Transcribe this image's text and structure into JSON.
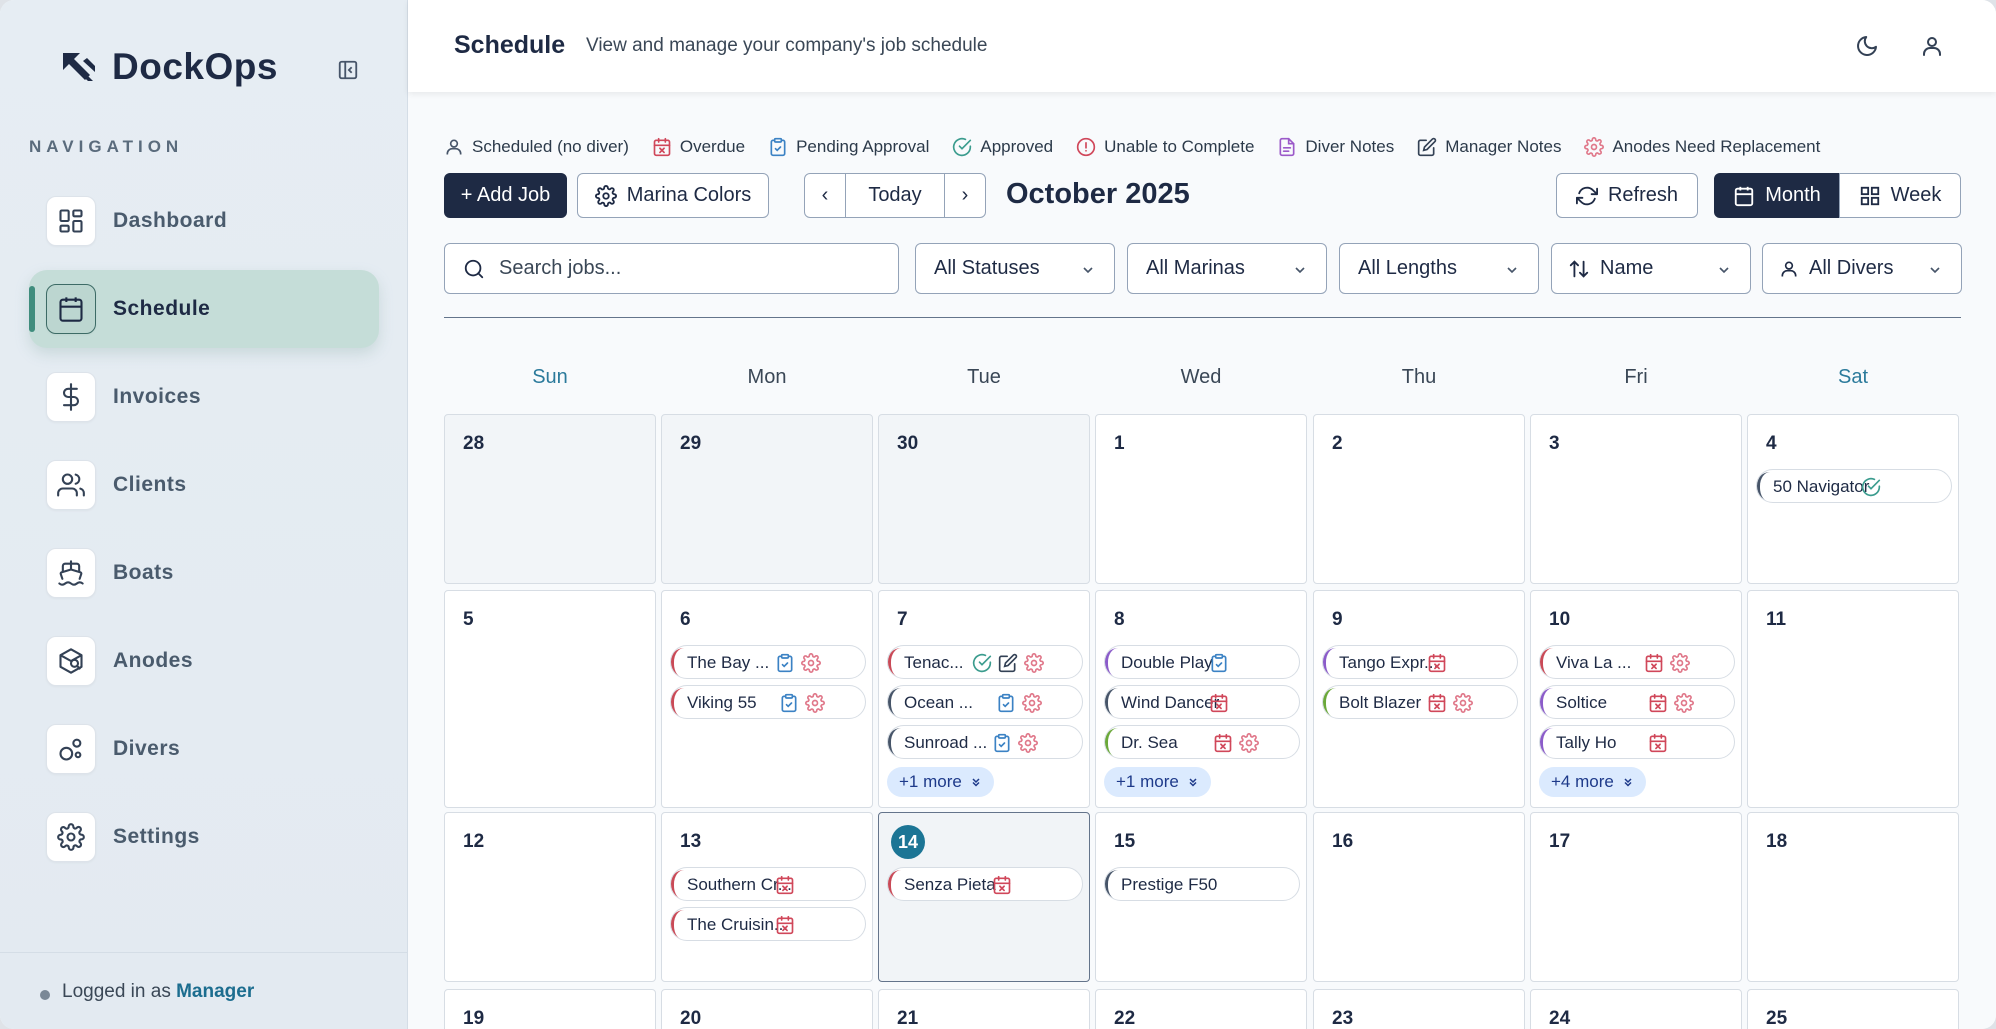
{
  "brand": {
    "name": "DockOps"
  },
  "sidebar": {
    "heading": "NAVIGATION",
    "items": [
      {
        "label": "Dashboard",
        "icon": "dashboard-icon"
      },
      {
        "label": "Schedule",
        "icon": "calendar-icon",
        "active": true
      },
      {
        "label": "Invoices",
        "icon": "dollar-icon"
      },
      {
        "label": "Clients",
        "icon": "users-icon"
      },
      {
        "label": "Boats",
        "icon": "boat-icon"
      },
      {
        "label": "Anodes",
        "icon": "anode-icon"
      },
      {
        "label": "Divers",
        "icon": "diver-icon"
      },
      {
        "label": "Settings",
        "icon": "gear-icon"
      }
    ],
    "footer": {
      "prefix": "Logged in as",
      "role": "Manager"
    }
  },
  "header": {
    "title": "Schedule",
    "subtitle": "View and manage your company's job schedule"
  },
  "legend": [
    {
      "label": "Scheduled (no diver)",
      "icon": "user-icon",
      "color": "#475569"
    },
    {
      "label": "Overdue",
      "icon": "calendar-x-icon",
      "color": "#d0475a"
    },
    {
      "label": "Pending Approval",
      "icon": "clipboard-icon",
      "color": "#3b82c4"
    },
    {
      "label": "Approved",
      "icon": "check-circle-icon",
      "color": "#3b9c8e"
    },
    {
      "label": "Unable to Complete",
      "icon": "alert-circle-icon",
      "color": "#d0475a"
    },
    {
      "label": "Diver Notes",
      "icon": "file-icon",
      "color": "#9b59c9"
    },
    {
      "label": "Manager Notes",
      "icon": "edit-icon",
      "color": "#334155"
    },
    {
      "label": "Anodes Need Replacement",
      "icon": "gear-icon",
      "color": "#e0788a"
    }
  ],
  "toolbar": {
    "add_job": "+ Add Job",
    "marina_colors": "Marina Colors",
    "prev": "‹",
    "today": "Today",
    "next": "›",
    "month_title": "October 2025",
    "refresh": "Refresh",
    "view_month": "Month",
    "view_week": "Week"
  },
  "filters": {
    "search_placeholder": "Search jobs...",
    "status": "All Statuses",
    "marinas": "All Marinas",
    "lengths": "All Lengths",
    "sort": "Name",
    "divers": "All Divers"
  },
  "calendar": {
    "weekdays": [
      "Sun",
      "Mon",
      "Tue",
      "Wed",
      "Thu",
      "Fri",
      "Sat"
    ],
    "weeks": [
      [
        {
          "day": "28",
          "muted": true,
          "jobs": []
        },
        {
          "day": "29",
          "muted": true,
          "jobs": []
        },
        {
          "day": "30",
          "muted": true,
          "jobs": []
        },
        {
          "day": "1",
          "jobs": []
        },
        {
          "day": "2",
          "jobs": []
        },
        {
          "day": "3",
          "jobs": []
        },
        {
          "day": "4",
          "jobs": [
            {
              "name": "50 Navigator",
              "color": "#475569",
              "icons": [
                "check"
              ]
            }
          ]
        }
      ],
      [
        {
          "day": "5",
          "jobs": []
        },
        {
          "day": "6",
          "jobs": [
            {
              "name": "The Bay ...",
              "color": "#c94a57",
              "icons": [
                "clip",
                "gear"
              ]
            },
            {
              "name": "Viking 55",
              "color": "#c94a57",
              "icons": [
                "clip",
                "gear"
              ]
            }
          ]
        },
        {
          "day": "7",
          "jobs": [
            {
              "name": "Tenac...",
              "color": "#c94a57",
              "icons": [
                "check",
                "edit",
                "gear"
              ]
            },
            {
              "name": "Ocean ...",
              "color": "#475569",
              "icons": [
                "clip",
                "gear"
              ]
            },
            {
              "name": "Sunroad ...",
              "color": "#475569",
              "icons": [
                "clip",
                "gear"
              ]
            }
          ],
          "more": "+1 more"
        },
        {
          "day": "8",
          "jobs": [
            {
              "name": "Double Play",
              "color": "#8b5cc9",
              "icons": [
                "clip"
              ]
            },
            {
              "name": "Wind Dancer",
              "color": "#475569",
              "icons": [
                "calx"
              ]
            },
            {
              "name": "Dr. Sea",
              "color": "#6ba83a",
              "icons": [
                "calx",
                "gear"
              ]
            }
          ],
          "more": "+1 more"
        },
        {
          "day": "9",
          "jobs": [
            {
              "name": "Tango Expr...",
              "color": "#8b5cc9",
              "icons": [
                "calx"
              ]
            },
            {
              "name": "Bolt Blazer",
              "color": "#6ba83a",
              "icons": [
                "calx",
                "gear"
              ]
            }
          ]
        },
        {
          "day": "10",
          "jobs": [
            {
              "name": "Viva La ...",
              "color": "#c94a57",
              "icons": [
                "calx",
                "gear"
              ]
            },
            {
              "name": "Soltice",
              "color": "#8b5cc9",
              "icons": [
                "calx",
                "gear"
              ]
            },
            {
              "name": "Tally Ho",
              "color": "#8b5cc9",
              "icons": [
                "calx"
              ]
            }
          ],
          "more": "+4 more"
        },
        {
          "day": "11",
          "jobs": []
        }
      ],
      [
        {
          "day": "12",
          "jobs": []
        },
        {
          "day": "13",
          "jobs": [
            {
              "name": "Southern Cr...",
              "color": "#c94a57",
              "icons": [
                "calx"
              ]
            },
            {
              "name": "The Cruisin...",
              "color": "#c94a57",
              "icons": [
                "calx"
              ]
            }
          ]
        },
        {
          "day": "14",
          "today": true,
          "jobs": [
            {
              "name": "Senza Pieta",
              "color": "#c94a57",
              "icons": [
                "calx"
              ]
            }
          ]
        },
        {
          "day": "15",
          "jobs": [
            {
              "name": "Prestige F50",
              "color": "#475569",
              "icons": []
            }
          ]
        },
        {
          "day": "16",
          "jobs": []
        },
        {
          "day": "17",
          "jobs": []
        },
        {
          "day": "18",
          "jobs": []
        }
      ],
      [
        {
          "day": "19",
          "jobs": []
        },
        {
          "day": "20",
          "jobs": []
        },
        {
          "day": "21",
          "jobs": []
        },
        {
          "day": "22",
          "jobs": []
        },
        {
          "day": "23",
          "jobs": []
        },
        {
          "day": "24",
          "jobs": []
        },
        {
          "day": "25",
          "jobs": []
        }
      ]
    ]
  }
}
